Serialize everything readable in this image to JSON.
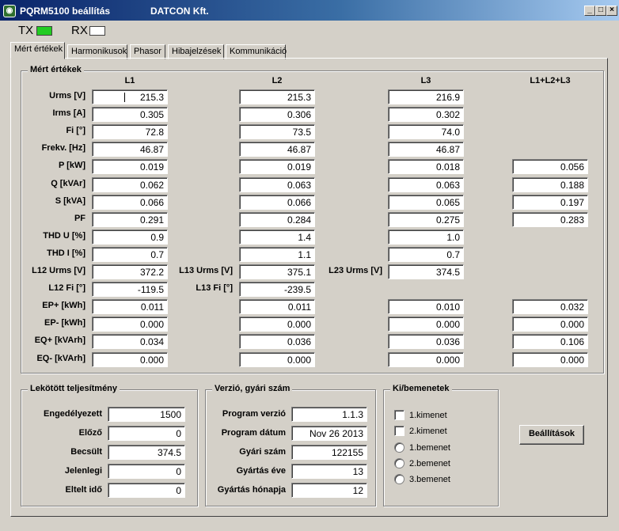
{
  "window": {
    "title": "PQRM5100 beállítás",
    "company": "DATCON Kft.",
    "minimize": "_",
    "maximize": "□",
    "close": "×"
  },
  "leds": {
    "tx": "TX",
    "tx_color": "#22cc22",
    "rx": "RX",
    "rx_color": "#ffffff"
  },
  "tabs": [
    "Mért értékek",
    "Harmonikusok",
    "Phasor",
    "Hibajelzések",
    "Kommunikáció"
  ],
  "measured": {
    "title": "Mért értékek",
    "columns": [
      "L1",
      "L2",
      "L3",
      "L1+L2+L3"
    ],
    "rows": [
      {
        "label": "Urms [V]",
        "l1": "215.3",
        "l2": "215.3",
        "l3": "216.9",
        "sum": ""
      },
      {
        "label": "Irms [A]",
        "l1": "0.305",
        "l2": "0.306",
        "l3": "0.302",
        "sum": ""
      },
      {
        "label": "Fi [°]",
        "l1": "72.8",
        "l2": "73.5",
        "l3": "74.0",
        "sum": ""
      },
      {
        "label": "Frekv. [Hz]",
        "l1": "46.87",
        "l2": "46.87",
        "l3": "46.87",
        "sum": ""
      },
      {
        "label": "P [kW]",
        "l1": "0.019",
        "l2": "0.019",
        "l3": "0.018",
        "sum": "0.056"
      },
      {
        "label": "Q [kVAr]",
        "l1": "0.062",
        "l2": "0.063",
        "l3": "0.063",
        "sum": "0.188"
      },
      {
        "label": "S [kVA]",
        "l1": "0.066",
        "l2": "0.066",
        "l3": "0.065",
        "sum": "0.197"
      },
      {
        "label": "PF",
        "l1": "0.291",
        "l2": "0.284",
        "l3": "0.275",
        "sum": "0.283"
      },
      {
        "label": "THD U [%]",
        "l1": "0.9",
        "l2": "1.4",
        "l3": "1.0",
        "sum": ""
      },
      {
        "label": "THD I [%]",
        "l1": "0.7",
        "l2": "1.1",
        "l3": "0.7",
        "sum": ""
      },
      {
        "label": "L12 Urms [V]",
        "l1": "372.2",
        "l2_label": "L13 Urms [V]",
        "l2": "375.1",
        "l3_label": "L23 Urms [V]",
        "l3": "374.5",
        "sum": ""
      },
      {
        "label": "L12 Fi [°]",
        "l1": "-119.5",
        "l2_label": "L13 Fi [°]",
        "l2": "-239.5",
        "l3": "",
        "sum": ""
      },
      {
        "label": "EP+ [kWh]",
        "l1": "0.011",
        "l2": "0.011",
        "l3": "0.010",
        "sum": "0.032"
      },
      {
        "label": "EP- [kWh]",
        "l1": "0.000",
        "l2": "0.000",
        "l3": "0.000",
        "sum": "0.000"
      },
      {
        "label": "EQ+ [kVArh]",
        "l1": "0.034",
        "l2": "0.036",
        "l3": "0.036",
        "sum": "0.106"
      },
      {
        "label": "EQ- [kVArh]",
        "l1": "0.000",
        "l2": "0.000",
        "l3": "0.000",
        "sum": "0.000"
      }
    ]
  },
  "power": {
    "title": "Lekötött teljesítmény",
    "rows": [
      {
        "label": "Engedélyezett",
        "value": "1500"
      },
      {
        "label": "Előző",
        "value": "0"
      },
      {
        "label": "Becsült",
        "value": "374.5"
      },
      {
        "label": "Jelenlegi",
        "value": "0"
      },
      {
        "label": "Eltelt idő",
        "value": "0"
      }
    ]
  },
  "version": {
    "title": "Verzió, gyári szám",
    "rows": [
      {
        "label": "Program verzió",
        "value": "1.1.3"
      },
      {
        "label": "Program dátum",
        "value": "Nov 26 2013"
      },
      {
        "label": "Gyári szám",
        "value": "122155"
      },
      {
        "label": "Gyártás éve",
        "value": "13"
      },
      {
        "label": "Gyártás hónapja",
        "value": "12"
      }
    ]
  },
  "io": {
    "title": "Ki/bemenetek",
    "outputs": [
      "1.kimenet",
      "2.kimenet"
    ],
    "inputs": [
      "1.bemenet",
      "2.bemenet",
      "3.bemenet"
    ]
  },
  "settings_button": "Beállítások"
}
